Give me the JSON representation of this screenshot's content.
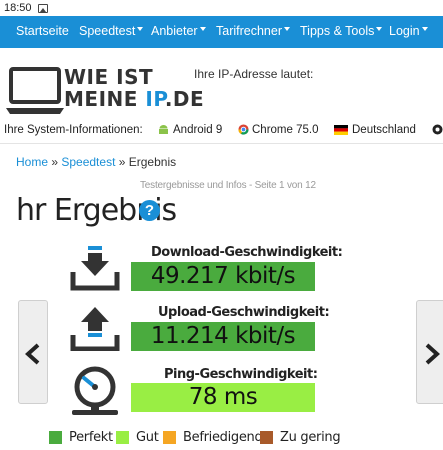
{
  "status": {
    "time": "18:50",
    "icon": "image-icon"
  },
  "nav": {
    "items": [
      {
        "label": "Startseite",
        "dropdown": false
      },
      {
        "label": "Speedtest",
        "dropdown": true
      },
      {
        "label": "Anbieter",
        "dropdown": true
      },
      {
        "label": "Tarifrechner",
        "dropdown": true
      },
      {
        "label": "Tipps & Tools",
        "dropdown": true
      },
      {
        "label": "Login",
        "dropdown": true
      }
    ],
    "color": "#1a8fd6"
  },
  "header": {
    "logo_line1": "WIE IST",
    "logo_line2_a": "MEINE ",
    "logo_line2_b": "IP",
    "logo_line2_c": ".DE",
    "ip_label": "Ihre IP-Adresse lautet:"
  },
  "sysinfo": {
    "label": "Ihre System-Informationen:",
    "os": "Android 9",
    "browser": "Chrome 75.0",
    "country": "Deutschland"
  },
  "breadcrumb": {
    "home": "Home",
    "sep1": " » ",
    "speedtest": "Speedtest",
    "sep2": " » ",
    "current": "Ergebnis"
  },
  "subinfo": "Testergebnisse und Infos - Seite 1 von 12",
  "title": "hr Ergebnis",
  "help_label": "?",
  "results": {
    "download_label": "Download-Geschwindigkeit:",
    "download_value": "49.217 kbit/s",
    "upload_label": "Upload-Geschwindigkeit:",
    "upload_value": "11.214 kbit/s",
    "ping_label": "Ping-Geschwindigkeit:",
    "ping_value": "78 ms"
  },
  "legend": [
    {
      "label": "Perfekt",
      "color": "#4aab3e"
    },
    {
      "label": "Gut",
      "color": "#99ee44"
    },
    {
      "label": "Befriedigend",
      "color": "#f5a623"
    },
    {
      "label": "Zu gering",
      "color": "#a85a2a"
    }
  ]
}
